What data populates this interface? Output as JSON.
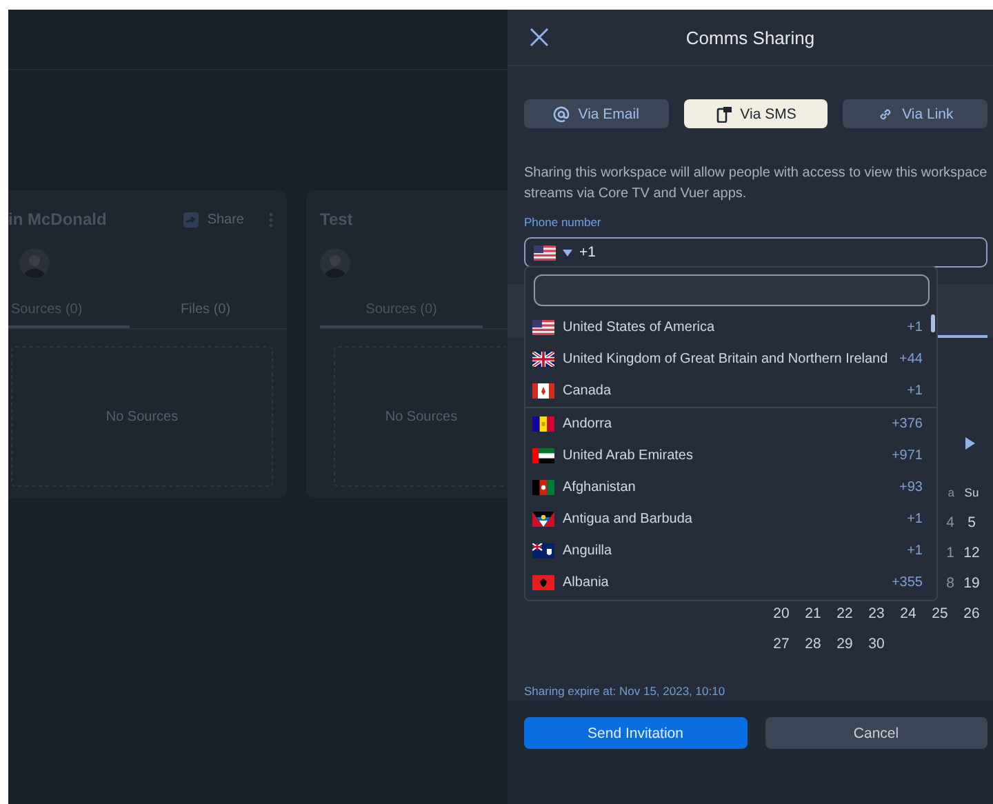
{
  "background": {
    "cards": [
      {
        "title": "in McDonald",
        "share": "Share",
        "tabs": [
          {
            "label": "Sources (0)",
            "selected": true
          },
          {
            "label": "Files (0)",
            "selected": false
          }
        ],
        "empty": "No Sources"
      },
      {
        "title": "Test",
        "tabs": [
          {
            "label": "Sources (0)",
            "selected": true
          }
        ],
        "empty": "No Sources"
      }
    ]
  },
  "dialog": {
    "title": "Comms Sharing",
    "tabs": [
      {
        "label": "Via Email",
        "kind": "email",
        "selected": false
      },
      {
        "label": "Via SMS",
        "kind": "sms",
        "selected": true
      },
      {
        "label": "Via Link",
        "kind": "link",
        "selected": false
      }
    ],
    "description": "Sharing this workspace will allow people with access to view this workspace streams via Core TV and Vuer apps.",
    "phone_label": "Phone number",
    "phone_value": "+1",
    "countries": [
      {
        "name": "United States of America",
        "code": "+1",
        "divider_after": false
      },
      {
        "name": "United Kingdom of Great Britain and Northern Ireland",
        "code": "+44",
        "divider_after": false
      },
      {
        "name": "Canada",
        "code": "+1",
        "divider_after": true
      },
      {
        "name": "Andorra",
        "code": "+376",
        "divider_after": false
      },
      {
        "name": "United Arab Emirates",
        "code": "+971",
        "divider_after": false
      },
      {
        "name": "Afghanistan",
        "code": "+93",
        "divider_after": false
      },
      {
        "name": "Antigua and Barbuda",
        "code": "+1",
        "divider_after": false
      },
      {
        "name": "Anguilla",
        "code": "+1",
        "divider_after": false
      },
      {
        "name": "Albania",
        "code": "+355",
        "divider_after": false
      }
    ],
    "calendar": {
      "weekdays": [
        "a",
        "Su"
      ],
      "rows": [
        {
          "kind": "partial",
          "days": [
            "4",
            "5"
          ]
        },
        {
          "kind": "partial",
          "days": [
            "1",
            "12"
          ]
        },
        {
          "kind": "partial",
          "days": [
            "8",
            "19"
          ]
        },
        {
          "kind": "full",
          "days": [
            "20",
            "21",
            "22",
            "23",
            "24",
            "25",
            "26"
          ]
        },
        {
          "kind": "full",
          "days": [
            "27",
            "28",
            "29",
            "30"
          ]
        }
      ]
    },
    "expire": "Sharing expire at: Nov 15, 2023, 10:10",
    "buttons": [
      {
        "label": "Send Invitation",
        "kind": "primary"
      },
      {
        "label": "Cancel",
        "kind": "secondary"
      }
    ]
  }
}
